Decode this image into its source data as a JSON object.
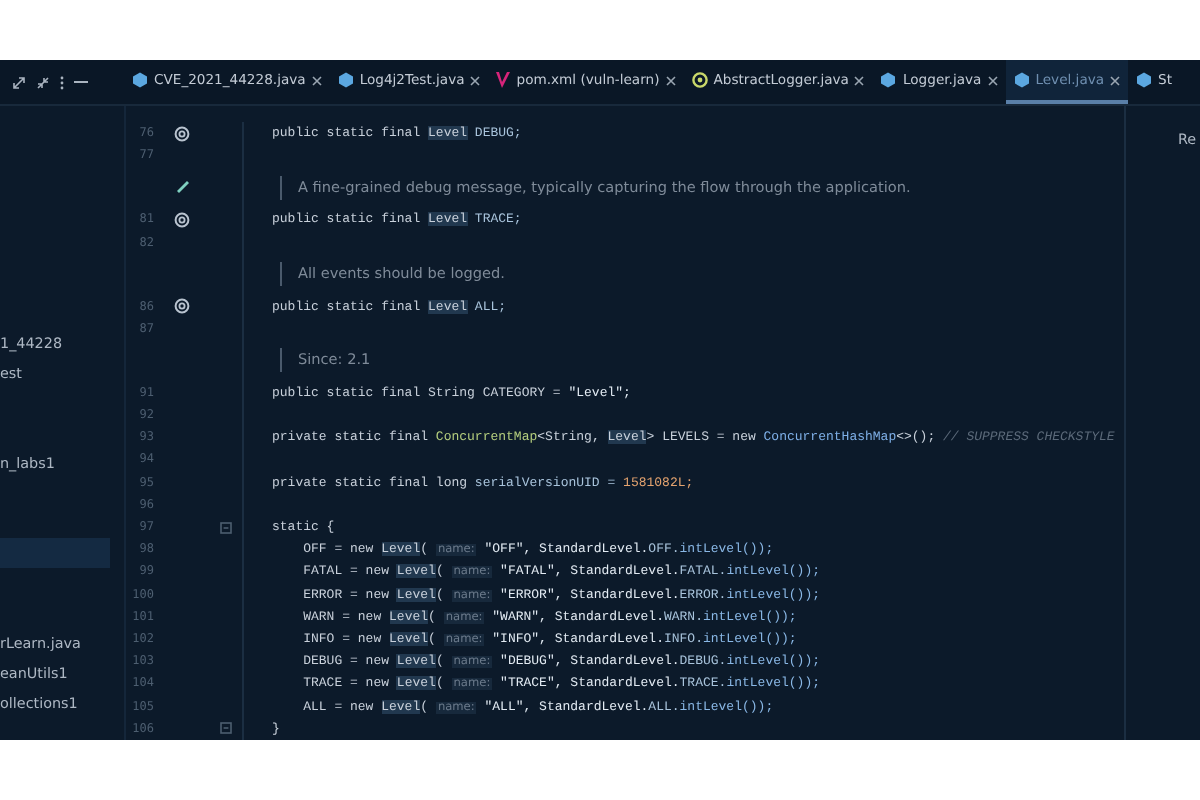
{
  "tabs": [
    {
      "label": "CVE_2021_44228.java",
      "kind": "java",
      "selected": false
    },
    {
      "label": "Log4j2Test.java",
      "kind": "java",
      "selected": false
    },
    {
      "label": "pom.xml (vuln-learn)",
      "kind": "maven",
      "selected": false
    },
    {
      "label": "AbstractLogger.java",
      "kind": "abstract",
      "selected": false
    },
    {
      "label": "Logger.java",
      "kind": "java",
      "selected": false
    },
    {
      "label": "Level.java",
      "kind": "java",
      "selected": true
    },
    {
      "label": "St",
      "kind": "java",
      "selected": false
    }
  ],
  "project_tree": [
    {
      "label": "1_44228",
      "selected": false
    },
    {
      "label": "est",
      "selected": false
    },
    {
      "label": "n_labs1",
      "selected": false
    },
    {
      "selected": true
    },
    {
      "label": "rLearn.java",
      "selected": false
    },
    {
      "label": "eanUtils1",
      "selected": false
    },
    {
      "label": "ollections1",
      "selected": false
    }
  ],
  "editor": {
    "lines": [
      {
        "kind": "code",
        "number": "76",
        "marker": {
          "kind": "override"
        },
        "tokens": [
          {
            "kind": "kw",
            "t": "public static final "
          },
          {
            "kind": "ref",
            "t": "Level"
          },
          {
            "kind": "field",
            "t": " DEBUG;"
          }
        ]
      },
      {
        "kind": "code",
        "number": "77"
      },
      {
        "kind": "doc",
        "marker": {
          "kind": "edit"
        },
        "text": "A fine-grained debug message, typically capturing the flow through the application."
      },
      {
        "kind": "code",
        "number": "81",
        "marker": {
          "kind": "override"
        },
        "tokens": [
          {
            "kind": "kw",
            "t": "public static final "
          },
          {
            "kind": "ref",
            "t": "Level"
          },
          {
            "kind": "field",
            "t": " TRACE;"
          }
        ]
      },
      {
        "kind": "code",
        "number": "82"
      },
      {
        "kind": "doc",
        "text": "All events should be logged."
      },
      {
        "kind": "code",
        "number": "86",
        "marker": {
          "kind": "override"
        },
        "tokens": [
          {
            "kind": "kw",
            "t": "public static final "
          },
          {
            "kind": "ref",
            "t": "Level"
          },
          {
            "kind": "field",
            "t": " ALL;"
          }
        ]
      },
      {
        "kind": "code",
        "number": "87"
      },
      {
        "kind": "doc",
        "text": "Since: 2.1"
      },
      {
        "kind": "code",
        "number": "91",
        "tokens": [
          {
            "kind": "kw",
            "t": "public static final "
          },
          {
            "kind": "plain",
            "t": "String CATEGORY = "
          },
          {
            "kind": "str",
            "t": "\"Level\";"
          }
        ]
      },
      {
        "kind": "code",
        "number": "92"
      },
      {
        "kind": "code",
        "number": "93",
        "tokens": [
          {
            "kind": "kw",
            "t": "private static final "
          },
          {
            "kind": "class",
            "t": "ConcurrentMap"
          },
          {
            "kind": "plain",
            "t": "<String, "
          },
          {
            "kind": "ref",
            "t": "Level"
          },
          {
            "kind": "plain",
            "t": "> LEVELS = new "
          },
          {
            "kind": "class2",
            "t": "ConcurrentHashMap"
          },
          {
            "kind": "plain",
            "t": "<>(); "
          },
          {
            "kind": "comment",
            "t": "// SUPPRESS CHECKSTYLE"
          }
        ]
      },
      {
        "kind": "code",
        "number": "94"
      },
      {
        "kind": "code",
        "number": "95",
        "tokens": [
          {
            "kind": "kw",
            "t": "private static final long "
          },
          {
            "kind": "field",
            "t": "serialVersionUID = "
          },
          {
            "kind": "num",
            "t": "1581082L;"
          }
        ]
      },
      {
        "kind": "code",
        "number": "96"
      },
      {
        "kind": "code",
        "number": "97",
        "marker": {
          "kind": "fold"
        },
        "tokens": [
          {
            "kind": "kw",
            "t": "static {"
          }
        ]
      },
      {
        "kind": "code",
        "number": "98",
        "tokens": [
          {
            "kind": "plain",
            "t": "    OFF = new "
          },
          {
            "kind": "ref",
            "t": "Level"
          },
          {
            "kind": "plain",
            "t": "( "
          },
          {
            "kind": "hint",
            "t": "name:"
          },
          {
            "kind": "str",
            "t": " \"OFF\", StandardLevel."
          },
          {
            "kind": "field",
            "t": "OFF."
          },
          {
            "kind": "method",
            "t": "intLevel());"
          }
        ]
      },
      {
        "kind": "code",
        "number": "99",
        "tokens": [
          {
            "kind": "plain",
            "t": "    FATAL = new "
          },
          {
            "kind": "ref",
            "t": "Level"
          },
          {
            "kind": "plain",
            "t": "( "
          },
          {
            "kind": "hint",
            "t": "name:"
          },
          {
            "kind": "str",
            "t": " \"FATAL\", StandardLevel."
          },
          {
            "kind": "field",
            "t": "FATAL."
          },
          {
            "kind": "method",
            "t": "intLevel());"
          }
        ]
      },
      {
        "kind": "code",
        "number": "100",
        "tokens": [
          {
            "kind": "plain",
            "t": "    ERROR = new "
          },
          {
            "kind": "ref",
            "t": "Level"
          },
          {
            "kind": "plain",
            "t": "( "
          },
          {
            "kind": "hint",
            "t": "name:"
          },
          {
            "kind": "str",
            "t": " \"ERROR\", StandardLevel."
          },
          {
            "kind": "field",
            "t": "ERROR."
          },
          {
            "kind": "method",
            "t": "intLevel());"
          }
        ]
      },
      {
        "kind": "code",
        "number": "101",
        "tokens": [
          {
            "kind": "plain",
            "t": "    WARN = new "
          },
          {
            "kind": "ref",
            "t": "Level"
          },
          {
            "kind": "plain",
            "t": "( "
          },
          {
            "kind": "hint",
            "t": "name:"
          },
          {
            "kind": "str",
            "t": " \"WARN\", StandardLevel."
          },
          {
            "kind": "field",
            "t": "WARN."
          },
          {
            "kind": "method",
            "t": "intLevel());"
          }
        ]
      },
      {
        "kind": "code",
        "number": "102",
        "tokens": [
          {
            "kind": "plain",
            "t": "    INFO = new "
          },
          {
            "kind": "ref",
            "t": "Level"
          },
          {
            "kind": "plain",
            "t": "( "
          },
          {
            "kind": "hint",
            "t": "name:"
          },
          {
            "kind": "str",
            "t": " \"INFO\", StandardLevel."
          },
          {
            "kind": "field",
            "t": "INFO."
          },
          {
            "kind": "method",
            "t": "intLevel());"
          }
        ]
      },
      {
        "kind": "code",
        "number": "103",
        "tokens": [
          {
            "kind": "plain",
            "t": "    DEBUG = new "
          },
          {
            "kind": "ref",
            "t": "Level"
          },
          {
            "kind": "plain",
            "t": "( "
          },
          {
            "kind": "hint",
            "t": "name:"
          },
          {
            "kind": "str",
            "t": " \"DEBUG\", StandardLevel."
          },
          {
            "kind": "field",
            "t": "DEBUG."
          },
          {
            "kind": "method",
            "t": "intLevel());"
          }
        ]
      },
      {
        "kind": "code",
        "number": "104",
        "tokens": [
          {
            "kind": "plain",
            "t": "    TRACE = new "
          },
          {
            "kind": "ref",
            "t": "Level"
          },
          {
            "kind": "plain",
            "t": "( "
          },
          {
            "kind": "hint",
            "t": "name:"
          },
          {
            "kind": "str",
            "t": " \"TRACE\", StandardLevel."
          },
          {
            "kind": "field",
            "t": "TRACE."
          },
          {
            "kind": "method",
            "t": "intLevel());"
          }
        ]
      },
      {
        "kind": "code",
        "number": "105",
        "tokens": [
          {
            "kind": "plain",
            "t": "    ALL = new "
          },
          {
            "kind": "ref",
            "t": "Level"
          },
          {
            "kind": "plain",
            "t": "( "
          },
          {
            "kind": "hint",
            "t": "name:"
          },
          {
            "kind": "str",
            "t": " \"ALL\", StandardLevel."
          },
          {
            "kind": "field",
            "t": "ALL."
          },
          {
            "kind": "method",
            "t": "intLevel());"
          }
        ]
      },
      {
        "kind": "code",
        "number": "106",
        "marker": {
          "kind": "fold"
        },
        "tokens": [
          {
            "kind": "plain",
            "t": "}"
          }
        ]
      }
    ]
  },
  "right_panel": {
    "label": "Re"
  }
}
